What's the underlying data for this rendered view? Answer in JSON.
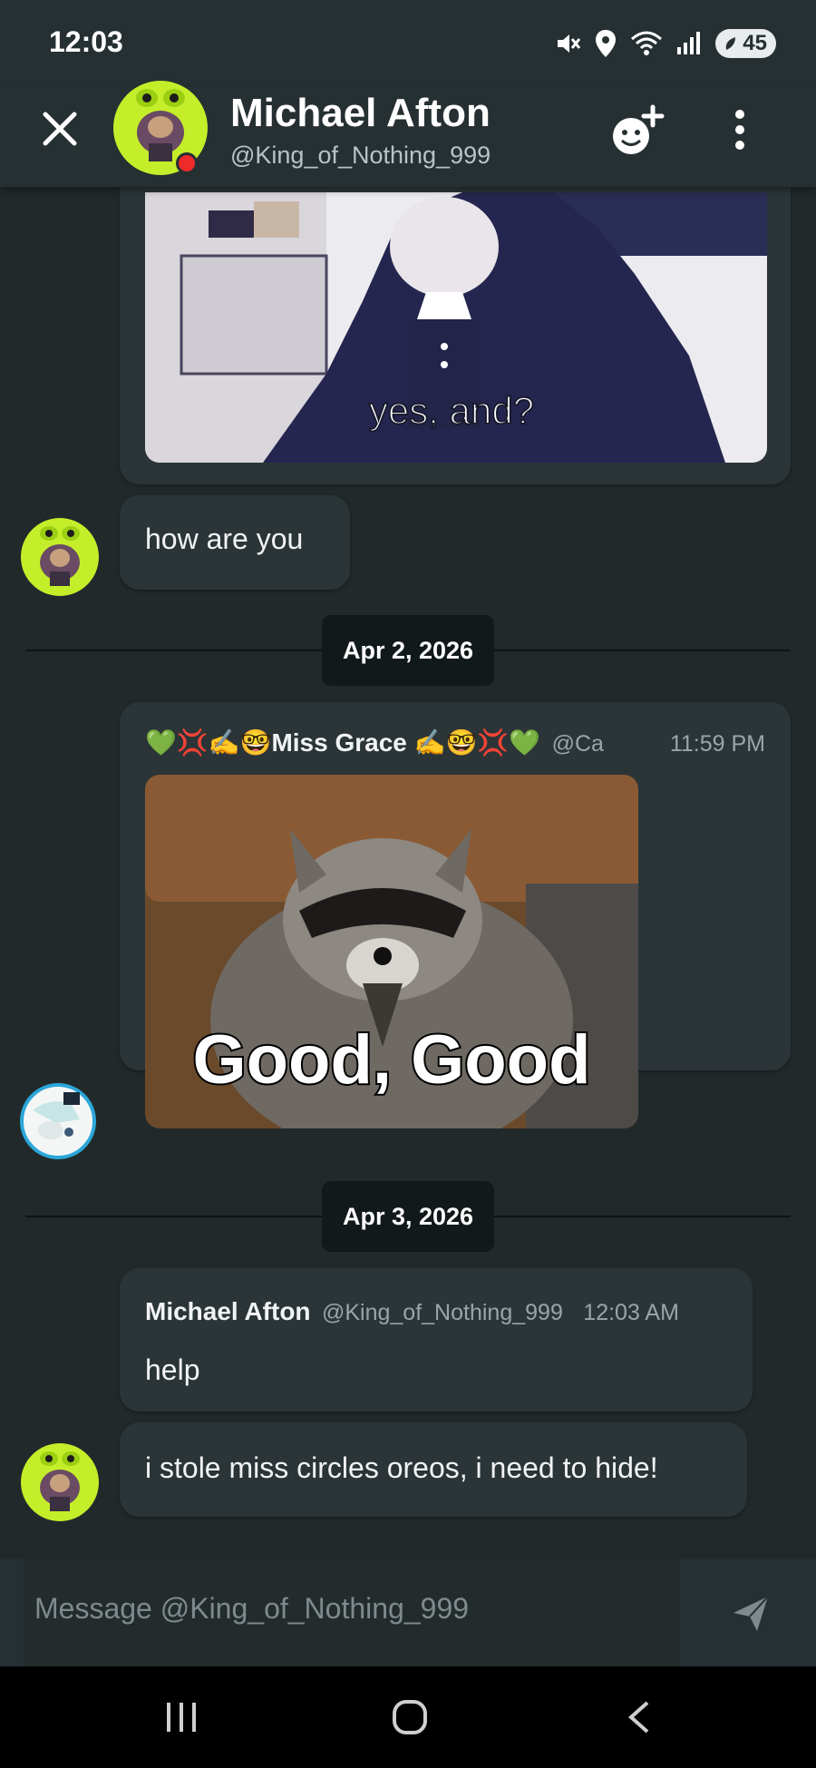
{
  "status_bar": {
    "time": "12:03",
    "battery": "45"
  },
  "header": {
    "title": "Michael Afton",
    "handle": "@King_of_Nothing_999"
  },
  "messages": {
    "meme_caption": "yes, and?",
    "how_are_you": "how are you",
    "date1": "Apr 2, 2026",
    "grace_name": "💚💢✍️🤓Miss Grace ✍️🤓💢💚",
    "grace_handle": "@Ca",
    "grace_time": "11:59 PM",
    "raccoon_caption": "Good, Good",
    "date2": "Apr 3, 2026",
    "michael_name": "Michael Afton",
    "michael_handle": "@King_of_Nothing_999",
    "michael_time": "12:03 AM",
    "help": "help",
    "last": "i stole miss circles oreos, i need to hide!"
  },
  "composer": {
    "placeholder": "Message @King_of_Nothing_999"
  },
  "colors": {
    "background": "#22292b",
    "bubble": "#2b3538",
    "header": "#263033",
    "date_pill": "#12191b",
    "presence_dnd": "#ee2a2a",
    "avatar_frog": "#c5ee2a"
  },
  "icons": [
    "close-icon",
    "add-friend-icon",
    "more-vertical-icon",
    "send-icon",
    "recents-nav-icon",
    "home-nav-icon",
    "back-nav-icon",
    "mute-icon",
    "location-icon",
    "wifi-icon",
    "signal-icon",
    "battery-icon"
  ]
}
